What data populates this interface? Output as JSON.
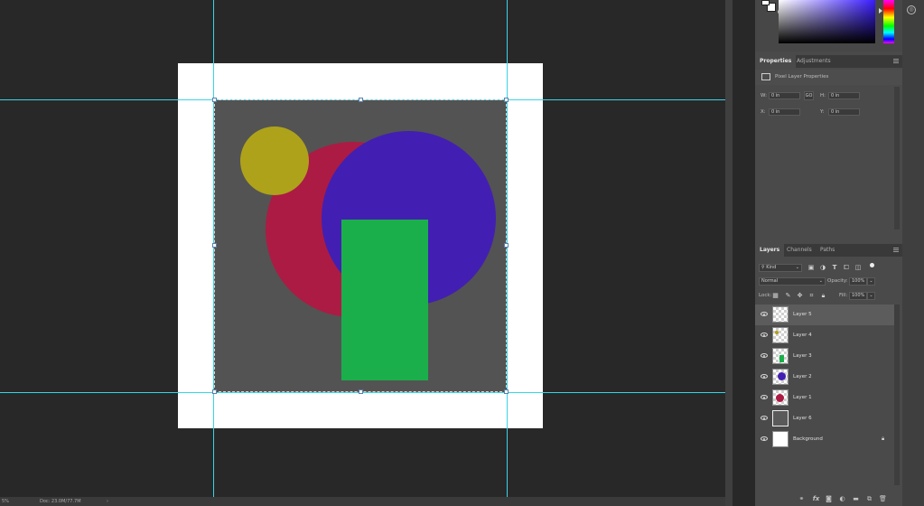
{
  "status": {
    "zoom": "5%",
    "doc": "Doc: 23.0M/77.7M",
    "arrow": "›"
  },
  "colors": {
    "canvas_bg": "#282828",
    "guide": "#38d5e6",
    "document_white": "#ffffff",
    "layer6_gray": "#535353",
    "olive_circle": "#aea21b",
    "crimson_circle": "#ac1b44",
    "purple_circle": "#421fb2",
    "green_rect": "#1aaf4b"
  },
  "properties": {
    "tabs": [
      {
        "label": "Properties",
        "active": true
      },
      {
        "label": "Adjustments",
        "active": false
      }
    ],
    "header": "Pixel Layer Properties",
    "w_label": "W:",
    "w_value": "0 in",
    "link_label": "GO",
    "h_label": "H:",
    "h_value": "0 in",
    "x_label": "X:",
    "x_value": "0 in",
    "y_label": "Y:",
    "y_value": "0 in"
  },
  "layers_panel": {
    "tabs": [
      {
        "label": "Layers",
        "active": true
      },
      {
        "label": "Channels",
        "active": false
      },
      {
        "label": "Paths",
        "active": false
      }
    ],
    "filter_label": "Kind",
    "blend_mode": "Normal",
    "opacity_label": "Opacity:",
    "opacity_value": "100%",
    "lock_label": "Lock:",
    "fill_label": "Fill:",
    "fill_value": "100%",
    "layers": [
      {
        "name": "Layer 5",
        "selected": true
      },
      {
        "name": "Layer 4",
        "selected": false
      },
      {
        "name": "Layer 3",
        "selected": false
      },
      {
        "name": "Layer 2",
        "selected": false
      },
      {
        "name": "Layer 1",
        "selected": false
      },
      {
        "name": "Layer 6",
        "selected": false
      },
      {
        "name": "Background",
        "selected": false,
        "locked": true
      }
    ],
    "bottom_icons": [
      "link-icon",
      "fx-icon",
      "mask-icon",
      "adjustment-icon",
      "folder-icon",
      "new-layer-icon",
      "trash-icon"
    ]
  }
}
